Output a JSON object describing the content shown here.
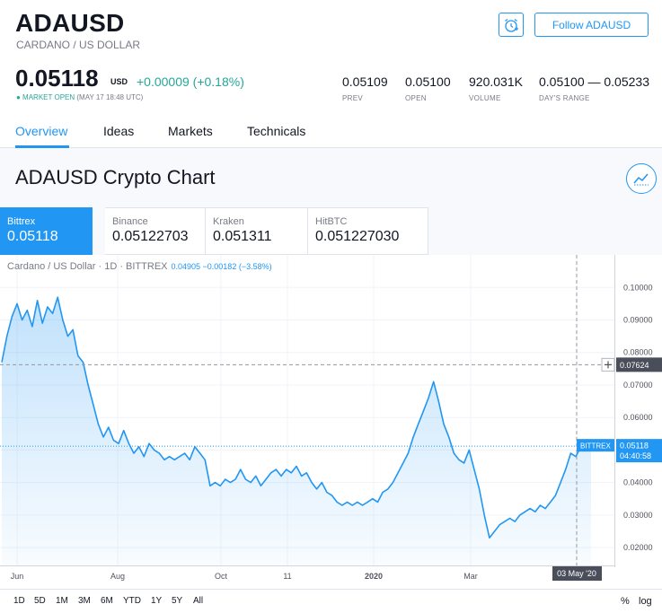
{
  "header": {
    "symbol": "ADAUSD",
    "subtitle": "CARDANO / US DOLLAR",
    "follow_label": "Follow ADAUSD",
    "alarm_icon": "alarm-clock-plus-icon"
  },
  "quote": {
    "price": "0.05118",
    "currency": "USD",
    "change": "+0.00009 (+0.18%)",
    "status": "● MARKET OPEN",
    "status_time": "(MAY 17 18:48 UTC)"
  },
  "stats": [
    {
      "value": "0.05109",
      "label": "PREV"
    },
    {
      "value": "0.05100",
      "label": "OPEN"
    },
    {
      "value": "920.031K",
      "label": "VOLUME"
    },
    {
      "value": "0.05100 — 0.05233",
      "label": "DAY'S RANGE"
    }
  ],
  "tabs": [
    {
      "label": "Overview",
      "active": true
    },
    {
      "label": "Ideas",
      "active": false
    },
    {
      "label": "Markets",
      "active": false
    },
    {
      "label": "Technicals",
      "active": false
    }
  ],
  "chart_section": {
    "title": "ADAUSD Crypto Chart",
    "icon": "chart-line-icon"
  },
  "exchanges": [
    {
      "name": "Bittrex",
      "value": "0.05118",
      "active": true
    },
    {
      "name": "Binance",
      "value": "0.05122703",
      "active": false
    },
    {
      "name": "Kraken",
      "value": "0.051311",
      "active": false
    },
    {
      "name": "HitBTC",
      "value": "0.051227030",
      "active": false
    }
  ],
  "chart_legend": {
    "text": "Cardano / US Dollar · 1D · BITTREX",
    "values": "0.04905  −0.00182 (−3.58%)"
  },
  "chart_overlay": {
    "crosshair_price": "0.07624",
    "last_label": "BITTREX",
    "last_price": "0.05118",
    "countdown": "04:40:58",
    "crosshair_date": "03 May '20"
  },
  "colors": {
    "accent": "#2196f3",
    "positive": "#26a69a",
    "text": "#131722",
    "muted": "#787b86"
  },
  "range_buttons": [
    "1D",
    "5D",
    "1M",
    "3M",
    "6M",
    "YTD",
    "1Y",
    "5Y",
    "All"
  ],
  "range_right": [
    "%",
    "log"
  ],
  "chart_data": {
    "type": "area",
    "series": [
      {
        "values": [
          0.077,
          0.085,
          0.091,
          0.095,
          0.09,
          0.093,
          0.088,
          0.096,
          0.089,
          0.094,
          0.092,
          0.097,
          0.09,
          0.085,
          0.087,
          0.079,
          0.077,
          0.07,
          0.064,
          0.058,
          0.054,
          0.057,
          0.053,
          0.052,
          0.056,
          0.052,
          0.049,
          0.051,
          0.048,
          0.052,
          0.05,
          0.049,
          0.047,
          0.048,
          0.047,
          0.048,
          0.049,
          0.047,
          0.051,
          0.049,
          0.047,
          0.039,
          0.04,
          0.039,
          0.041,
          0.04,
          0.041,
          0.044,
          0.041,
          0.04,
          0.042,
          0.039,
          0.041,
          0.043,
          0.044,
          0.042,
          0.044,
          0.043,
          0.045,
          0.042,
          0.043,
          0.04,
          0.038,
          0.04,
          0.037,
          0.036,
          0.034,
          0.033,
          0.034,
          0.033,
          0.034,
          0.033,
          0.034,
          0.035,
          0.034,
          0.037,
          0.038,
          0.04,
          0.043,
          0.046,
          0.049,
          0.054,
          0.058,
          0.062,
          0.066,
          0.071,
          0.065,
          0.058,
          0.054,
          0.049,
          0.047,
          0.046,
          0.05,
          0.044,
          0.038,
          0.03,
          0.023,
          0.025,
          0.027,
          0.028,
          0.029,
          0.028,
          0.03,
          0.031,
          0.032,
          0.031,
          0.033,
          0.032,
          0.034,
          0.036,
          0.04,
          0.044,
          0.049,
          0.048,
          0.051,
          0.05,
          0.051
        ]
      }
    ],
    "x_tick_labels": [
      "Jun",
      "Aug",
      "Oct",
      "11",
      "2020",
      "Mar",
      "May"
    ],
    "y_tick_labels": [
      "0.10000",
      "0.09000",
      "0.08000",
      "0.07000",
      "0.06000",
      "0.05000",
      "0.04000",
      "0.03000",
      "0.02000"
    ],
    "y_ticks": [
      0.1,
      0.09,
      0.08,
      0.07,
      0.06,
      0.05,
      0.04,
      0.03,
      0.02
    ],
    "ylim": [
      0.0145,
      0.1045
    ],
    "crosshair_value": 0.07624,
    "last_value": 0.05118,
    "grid": true
  }
}
